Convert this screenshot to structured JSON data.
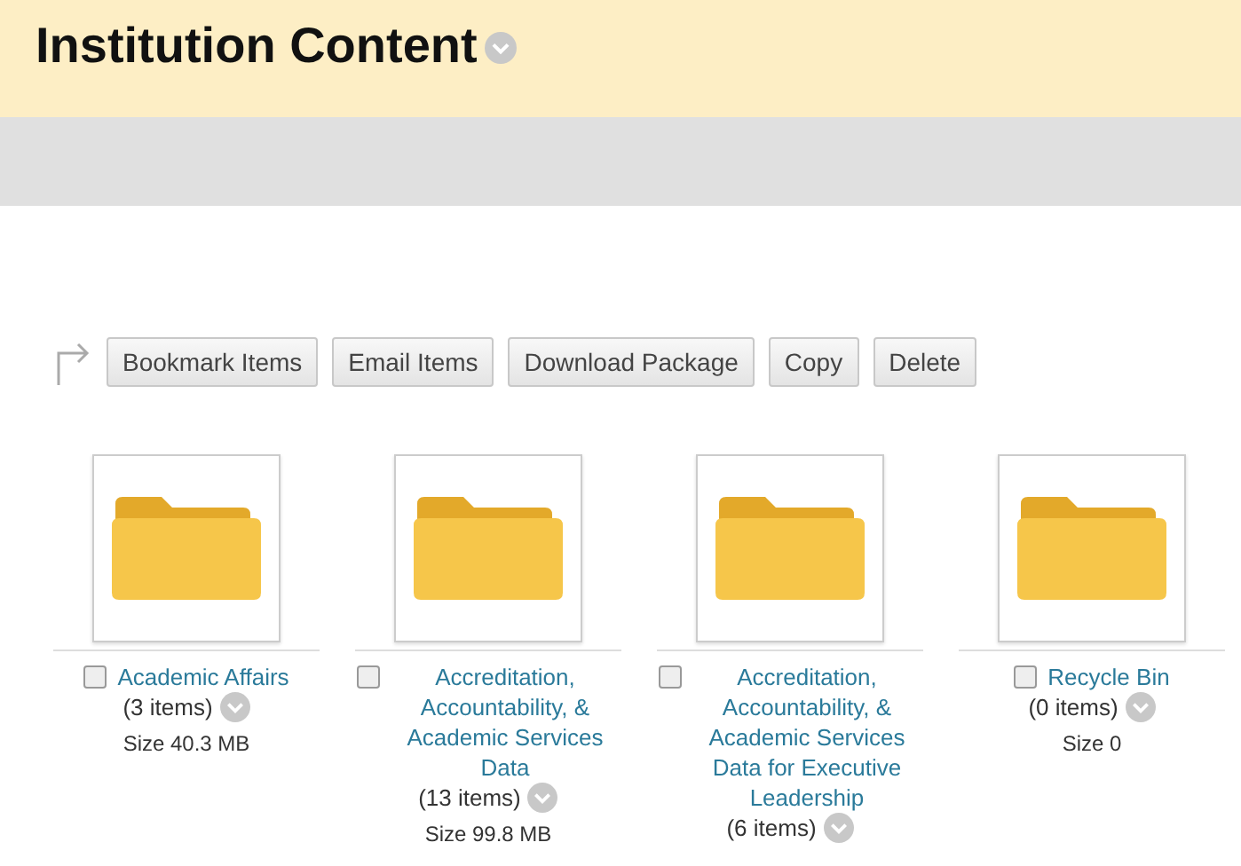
{
  "header": {
    "title": "Institution Content"
  },
  "toolbar": {
    "buttons": [
      "Bookmark Items",
      "Email Items",
      "Download Package",
      "Copy",
      "Delete"
    ]
  },
  "folders": [
    {
      "name": "Academic Affairs",
      "count": "(3 items)",
      "size": "Size 40.3 MB",
      "checked": false
    },
    {
      "name": "Accreditation, Accountability, & Academic Services Data",
      "count": "(13 items)",
      "size": "Size 99.8 MB",
      "checked": false
    },
    {
      "name": "Accreditation, Accountability, & Academic Services Data for Executive Leadership",
      "count": "(6 items)",
      "checked": false
    },
    {
      "name": "Recycle Bin",
      "count": "(0 items)",
      "size": "Size 0",
      "checked": false
    }
  ]
}
